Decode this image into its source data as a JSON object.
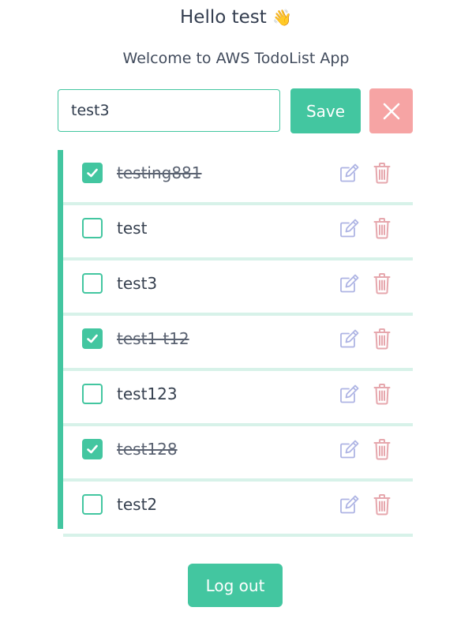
{
  "header": {
    "greeting": "Hello test",
    "wave_emoji": "👋",
    "subtitle": "Welcome to AWS TodoList App"
  },
  "form": {
    "input_value": "test3",
    "save_label": "Save",
    "cancel_icon": "close-icon"
  },
  "todos": [
    {
      "text": "testing881",
      "done": true
    },
    {
      "text": "test",
      "done": false
    },
    {
      "text": "test3",
      "done": false
    },
    {
      "text": "test1-t12",
      "done": true
    },
    {
      "text": "test123",
      "done": false
    },
    {
      "text": "test128",
      "done": true
    },
    {
      "text": "test2",
      "done": false
    }
  ],
  "icons": {
    "edit": "edit-icon",
    "delete": "trash-icon",
    "check": "check-icon"
  },
  "footer": {
    "logout_label": "Log out"
  },
  "colors": {
    "accent": "#43c6a0",
    "accent_light": "#d7f2e9",
    "cancel": "#f6a4a4",
    "edit_icon": "#aeb4e4",
    "delete_icon": "#e6a7ad"
  }
}
